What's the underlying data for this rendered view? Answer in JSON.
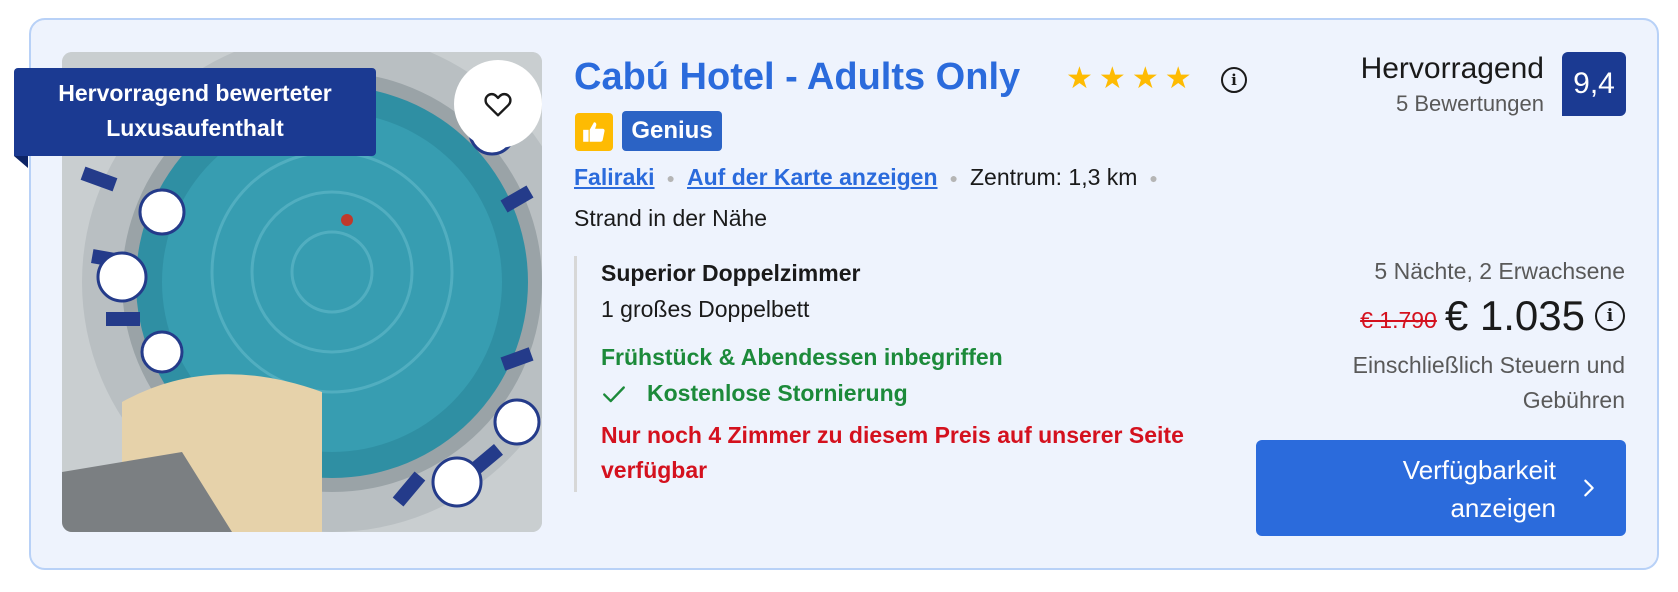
{
  "hotel": {
    "badge": "Hervorragend bewerteter Luxusaufenthalt",
    "name": "Cabú Hotel - Adults Only",
    "stars": 4,
    "genius_label": "Genius",
    "location_link": "Faliraki",
    "map_link": "Auf der Karte anzeigen",
    "distance": "Zentrum: 1,3 km",
    "beach": "Strand in der Nähe"
  },
  "rating": {
    "word": "Hervorragend",
    "reviews": "5 Bewertungen",
    "score": "9,4"
  },
  "room": {
    "name": "Superior Doppelzimmer",
    "bed": "1 großes Doppelbett",
    "meal": "Frühstück & Abendessen inbegriffen",
    "cancellation": "Kostenlose Stornierung",
    "availability": "Nur noch 4 Zimmer zu diesem Preis auf unserer Seite verfügbar"
  },
  "pricing": {
    "stay": "5 Nächte, 2 Erwachsene",
    "old_price": "€ 1.790",
    "price": "€ 1.035",
    "tax_note": "Einschließlich Steuern und Gebühren"
  },
  "cta": {
    "label": "Verfügbarkeit anzeigen"
  },
  "colors": {
    "accent": "#2b6bdc",
    "brand_dark": "#1b3a92",
    "success": "#1c8a3a",
    "alert": "#d4111e",
    "star": "#febb02",
    "card_bg": "#eef3fd"
  },
  "icons": [
    "heart-icon",
    "star-icon",
    "info-icon",
    "thumbs-up-icon",
    "checkmark-icon",
    "chevron-right-icon"
  ]
}
